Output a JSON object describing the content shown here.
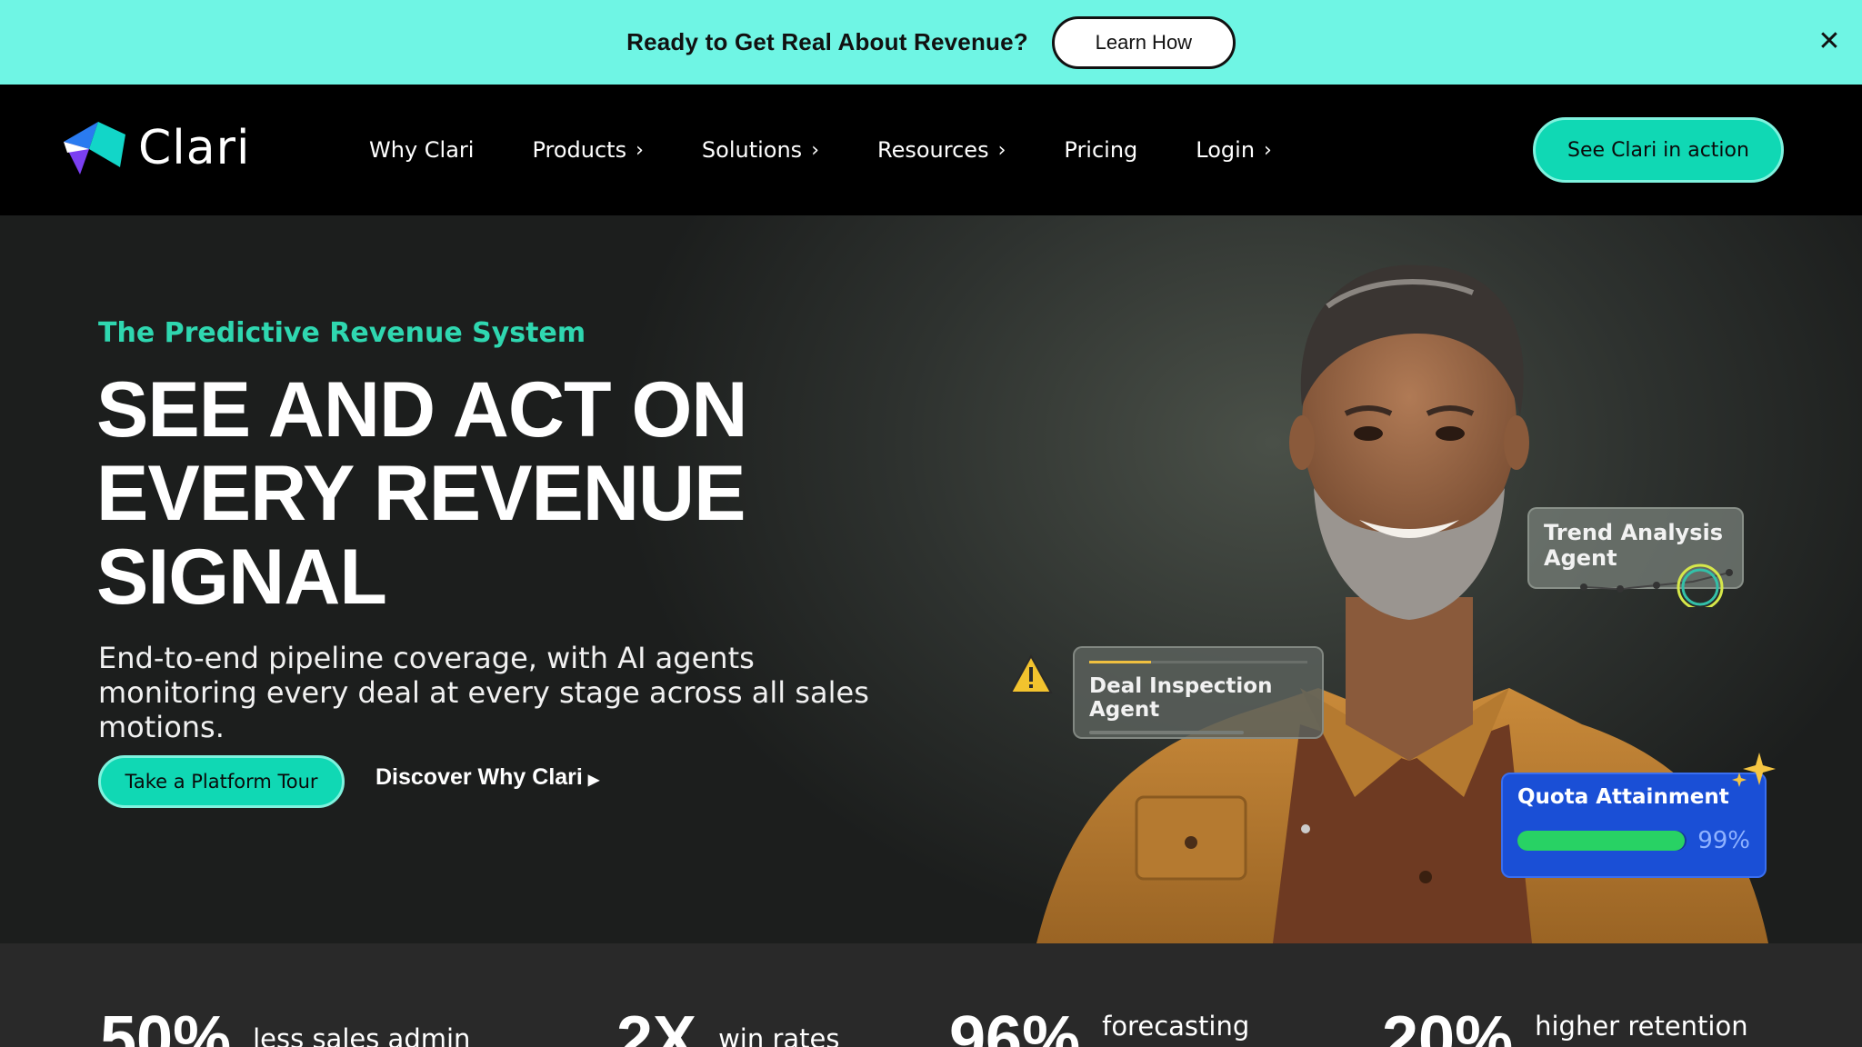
{
  "announcement": {
    "text": "Ready to Get Real About Revenue?",
    "button": "Learn How",
    "close": "✕"
  },
  "nav": {
    "brand": "Clari",
    "items": [
      {
        "label": "Why Clari",
        "chevron": ""
      },
      {
        "label": "Products",
        "chevron": "›"
      },
      {
        "label": "Solutions",
        "chevron": "›"
      },
      {
        "label": "Resources",
        "chevron": "›"
      },
      {
        "label": "Pricing",
        "chevron": ""
      },
      {
        "label": "Login",
        "chevron": "›"
      }
    ],
    "cta": "See Clari in action"
  },
  "hero": {
    "eyebrow": "The Predictive Revenue System",
    "headline_lines": [
      "SEE AND ACT ON",
      "EVERY REVENUE",
      "SIGNAL"
    ],
    "subtext": "End-to-end pipeline coverage, with AI agents monitoring every deal at every stage across all sales motions.",
    "primary_button": "Take a Platform Tour",
    "secondary_link": "Discover Why Clari",
    "cards": {
      "trend": {
        "title_line1": "Trend Analysis",
        "title_line2": "Agent"
      },
      "deal": {
        "title": "Deal Inspection Agent"
      },
      "quota": {
        "title": "Quota Attainment",
        "value": "99%",
        "progress": 0.99
      }
    }
  },
  "stats": [
    {
      "number": "50%",
      "label": "less sales admin"
    },
    {
      "number": "2X",
      "label": "win rates"
    },
    {
      "number": "96%",
      "label": "forecasting"
    },
    {
      "number": "20%",
      "label": "higher retention"
    }
  ],
  "colors": {
    "announce_bg": "#6ff5e4",
    "accent": "#10d8b4",
    "eyebrow": "#2fd7b0",
    "quota_card": "#1a4fd6",
    "quota_fill": "#28d264"
  }
}
